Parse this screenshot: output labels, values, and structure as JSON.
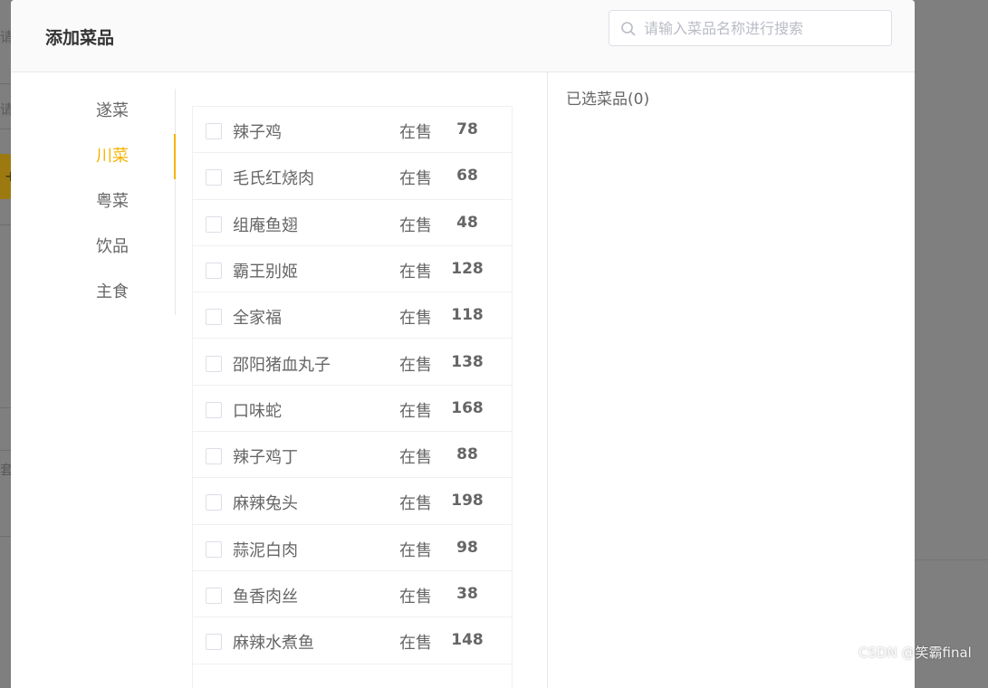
{
  "background": {
    "fragments": [
      "请",
      "请",
      "+",
      "套"
    ]
  },
  "dialog": {
    "title": "添加菜品",
    "search": {
      "placeholder": "请输入菜品名称进行搜索",
      "value": ""
    }
  },
  "categories": [
    {
      "label": "遂菜",
      "active": false
    },
    {
      "label": "川菜",
      "active": true
    },
    {
      "label": "粤菜",
      "active": false
    },
    {
      "label": "饮品",
      "active": false
    },
    {
      "label": "主食",
      "active": false
    }
  ],
  "dishes": [
    {
      "name": "辣子鸡",
      "status": "在售",
      "price": "78"
    },
    {
      "name": "毛氏红烧肉",
      "status": "在售",
      "price": "68"
    },
    {
      "name": "组庵鱼翅",
      "status": "在售",
      "price": "48"
    },
    {
      "name": "霸王别姬",
      "status": "在售",
      "price": "128"
    },
    {
      "name": "全家福",
      "status": "在售",
      "price": "118"
    },
    {
      "name": "邵阳猪血丸子",
      "status": "在售",
      "price": "138"
    },
    {
      "name": "口味蛇",
      "status": "在售",
      "price": "168"
    },
    {
      "name": "辣子鸡丁",
      "status": "在售",
      "price": "88"
    },
    {
      "name": "麻辣兔头",
      "status": "在售",
      "price": "198"
    },
    {
      "name": "蒜泥白肉",
      "status": "在售",
      "price": "98"
    },
    {
      "name": "鱼香肉丝",
      "status": "在售",
      "price": "38"
    },
    {
      "name": "麻辣水煮鱼",
      "status": "在售",
      "price": "148"
    }
  ],
  "selected": {
    "title": "已选菜品(0)"
  },
  "watermark": "CSDN @笑霸final",
  "colors": {
    "accent": "#f5b301",
    "text": "#666666",
    "title": "#333333",
    "overlay": "#7f7f7f"
  }
}
